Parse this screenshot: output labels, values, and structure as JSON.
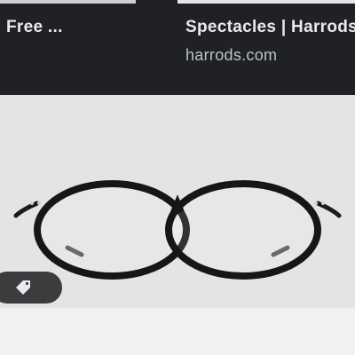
{
  "results": [
    {
      "title": "Free ..."
    },
    {
      "title": "Spectacles | Harrods",
      "domain": "harrods.com"
    }
  ],
  "image": {
    "subject": "black round-frame spectacles",
    "badge_icon": "price-tag-icon"
  },
  "colors": {
    "top_bar_bg": "#202124",
    "title_text": "#e8eaed",
    "domain_text": "#bdc1c6",
    "image_bg": "#e4e4e4",
    "badge_bg": "#3c3c3e"
  }
}
